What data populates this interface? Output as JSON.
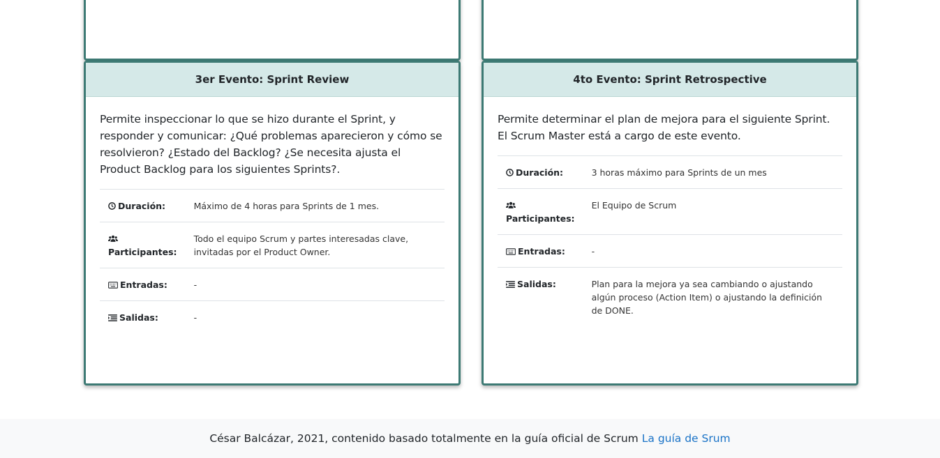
{
  "cards": [
    {
      "title": "3er Evento: Sprint Review",
      "description": "Permite inspeccionar lo que se hizo durante el Sprint, y responder y comunicar: ¿Qué problemas aparecieron y cómo se resolvieron? ¿Estado del Backlog? ¿Se necesita ajusta el Product Backlog para los siguientes Sprints?.",
      "rows": [
        {
          "icon": "clock-icon",
          "label": "Duración:",
          "value": "Máximo de 4 horas para Sprints de 1 mes."
        },
        {
          "icon": "users-icon",
          "label": "Participantes:",
          "value": "Todo el equipo Scrum y partes interesadas clave, invitadas por el Product Owner."
        },
        {
          "icon": "keyboard-icon",
          "label": "Entradas:",
          "value": "-"
        },
        {
          "icon": "list-icon",
          "label": "Salidas:",
          "value": "-"
        }
      ]
    },
    {
      "title": "4to Evento: Sprint Retrospective",
      "description": "Permite determinar el plan de mejora para el siguiente Sprint. El Scrum Master está a cargo de este evento.",
      "rows": [
        {
          "icon": "clock-icon",
          "label": "Duración:",
          "value": "3 horas máximo para Sprints de un mes"
        },
        {
          "icon": "users-icon",
          "label": "Participantes:",
          "value": "El Equipo de Scrum"
        },
        {
          "icon": "keyboard-icon",
          "label": "Entradas:",
          "value": "-"
        },
        {
          "icon": "list-icon",
          "label": "Salidas:",
          "value": "Plan para la mejora ya sea cambiando o ajustando algún proceso (Action Item) o ajustando la definición de DONE."
        }
      ]
    }
  ],
  "footer": {
    "text": "César Balcázar, 2021, contenido basado totalmente en la guía oficial de Scrum",
    "link_label": "La guía de Srum"
  },
  "colors": {
    "card_border": "#3d7a74",
    "card_header_bg": "#d5e9e8",
    "footer_bg": "#f8f9fa",
    "link": "#1a73c7"
  }
}
